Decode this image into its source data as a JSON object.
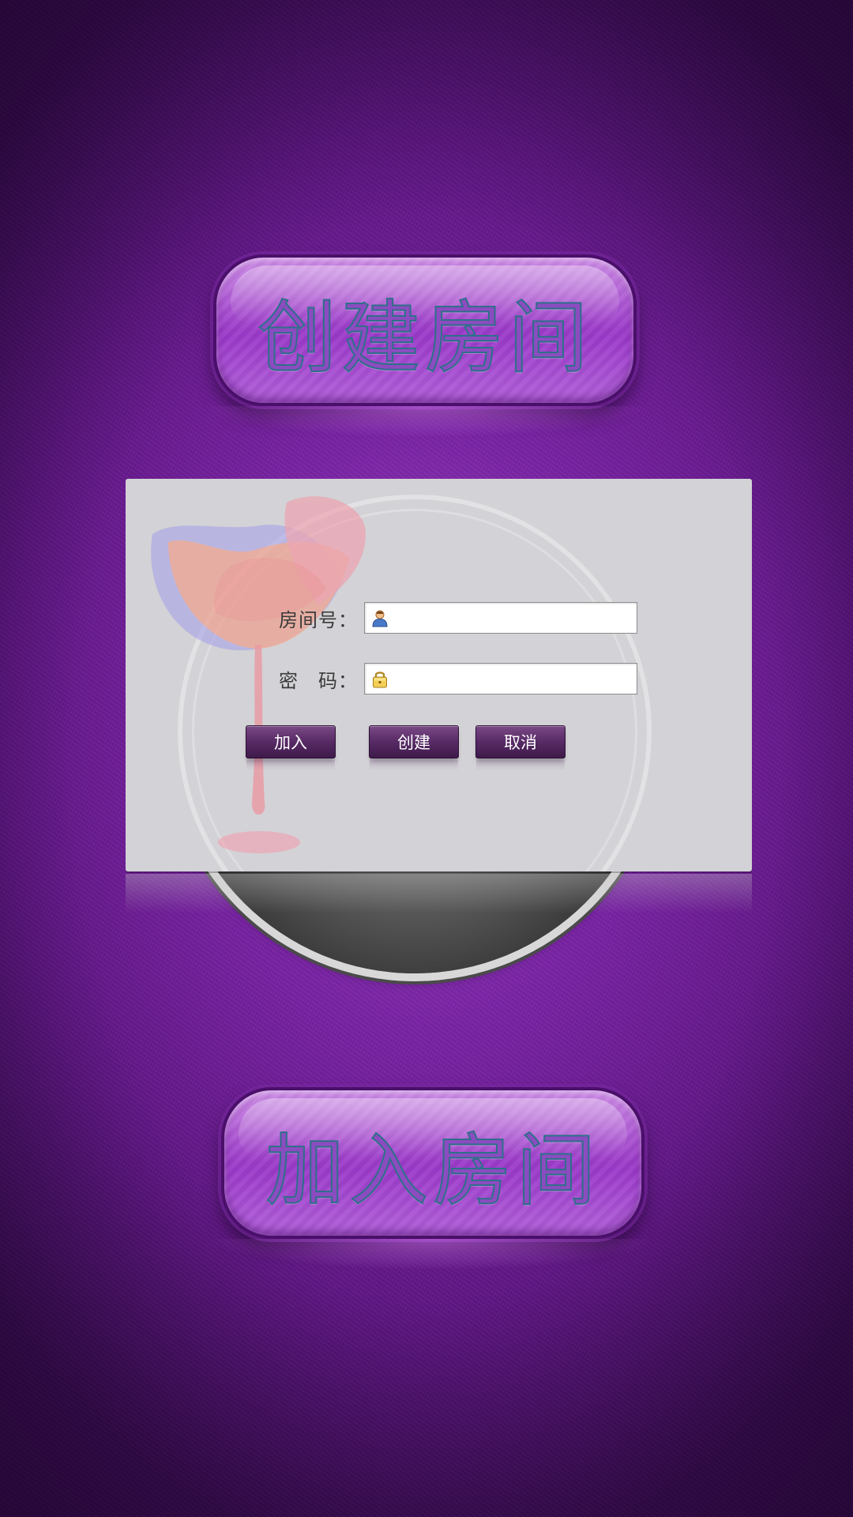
{
  "header_button": {
    "label": "创建房间"
  },
  "footer_button": {
    "label": "加入房间"
  },
  "dialog": {
    "room_field": {
      "label": "房间号：",
      "value": "",
      "icon": "user-icon"
    },
    "password_field": {
      "label": "密　码：",
      "value": "",
      "icon": "lock-icon"
    },
    "buttons": {
      "join": "加入",
      "create": "创建",
      "cancel": "取消"
    }
  },
  "colors": {
    "background": "#7a22a6",
    "big_button": "#a64ad4",
    "big_button_text_stroke": "#2e6f8a",
    "dialog_bg": "#d3d2d6",
    "small_button": "#5a2c68"
  }
}
